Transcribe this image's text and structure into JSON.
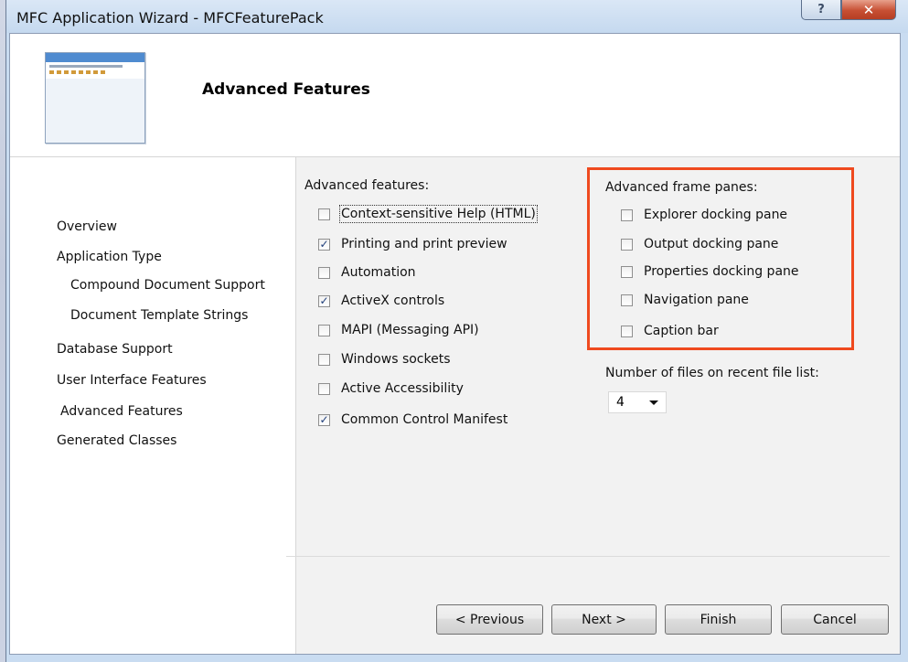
{
  "window": {
    "title": "MFC Application Wizard - MFCFeaturePack",
    "help_glyph": "?",
    "close_glyph": "✕"
  },
  "header": {
    "title": "Advanced Features"
  },
  "nav": {
    "items": [
      {
        "label": "Overview"
      },
      {
        "label": "Application Type"
      },
      {
        "label": "Compound Document Support"
      },
      {
        "label": "Document Template Strings"
      },
      {
        "label": "Database Support"
      },
      {
        "label": "User Interface Features"
      },
      {
        "label": "Advanced Features"
      },
      {
        "label": "Generated Classes"
      }
    ]
  },
  "advanced_features": {
    "label": "Advanced features:",
    "options": [
      {
        "label": "Context-sensitive Help (HTML)",
        "checked": false
      },
      {
        "label": "Printing and print preview",
        "checked": true
      },
      {
        "label": "Automation",
        "checked": false
      },
      {
        "label": "ActiveX controls",
        "checked": true
      },
      {
        "label": "MAPI (Messaging API)",
        "checked": false
      },
      {
        "label": "Windows sockets",
        "checked": false
      },
      {
        "label": "Active Accessibility",
        "checked": false
      },
      {
        "label": "Common Control Manifest",
        "checked": true
      }
    ]
  },
  "frame_panes": {
    "label": "Advanced frame panes:",
    "options": [
      {
        "label": "Explorer docking pane",
        "checked": false
      },
      {
        "label": "Output docking pane",
        "checked": false
      },
      {
        "label": "Properties docking pane",
        "checked": false
      },
      {
        "label": "Navigation pane",
        "checked": false
      },
      {
        "label": "Caption bar",
        "checked": false
      }
    ]
  },
  "recent_files": {
    "label": "Number of files on recent file list:",
    "value": "4"
  },
  "buttons": {
    "previous": "< Previous",
    "next": "Next >",
    "finish": "Finish",
    "cancel": "Cancel"
  },
  "colors": {
    "highlight_box": "#ef4a1f",
    "checkmark": "#1f3e7a"
  },
  "icons": {
    "checkmark": "✓"
  }
}
